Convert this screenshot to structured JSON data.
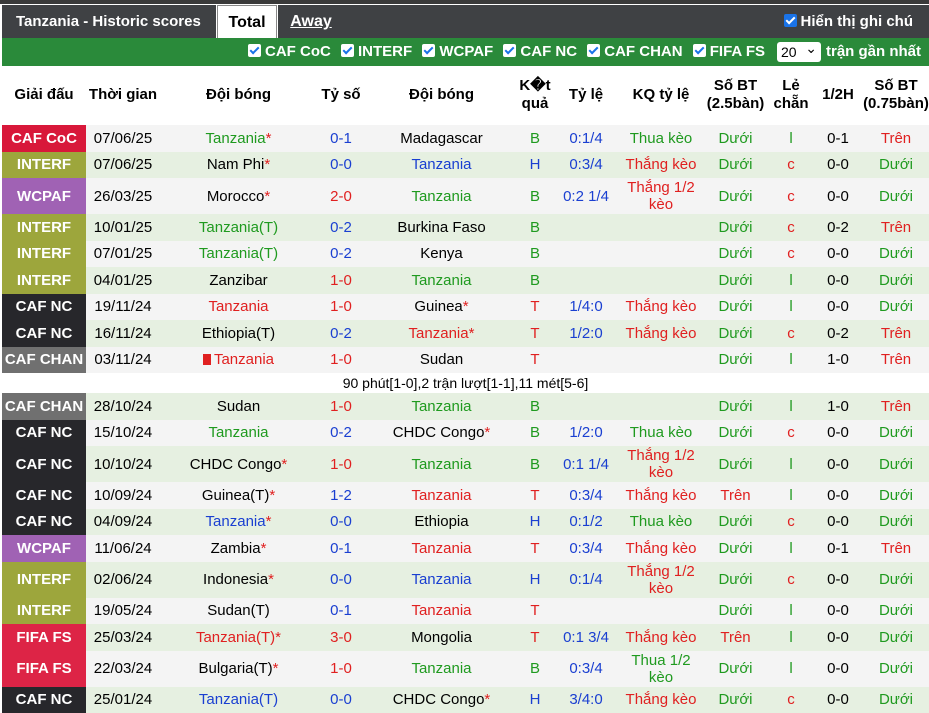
{
  "header": {
    "title": "Tanzania - Historic scores",
    "tab_total": "Total",
    "tab_away": "Away",
    "show_name_label": "Hiển thị ghi chú"
  },
  "filters": {
    "items": [
      "CAF CoC",
      "INTERF",
      "WCPAF",
      "CAF NC",
      "CAF CHAN",
      "FIFA FS"
    ],
    "count_value": "20",
    "recent_label": "trận gần nhất"
  },
  "columns": [
    "Giải đấu",
    "Thời gian",
    "Đội bóng",
    "Tỷ số",
    "Đội bóng",
    "K�t quả",
    "Tỷ lệ",
    "KQ tỷ lệ",
    "Số BT (2.5bàn)",
    "Lẻ chẵn",
    "1/2H",
    "Số BT (0.75bàn)"
  ],
  "colors": {
    "CAF CoC": "#d8183a",
    "INTERF": "#9da63c",
    "WCPAF": "#a062b4",
    "CAF NC": "#27272b",
    "CAF CHAN": "#707070",
    "FIFA FS": "#dd2446"
  },
  "rows": [
    {
      "comp": "CAF CoC",
      "date": "07/06/25",
      "home": "Tanzania",
      "home_mark": "*",
      "home_color": "green",
      "score": "0-1",
      "score_color": "blue",
      "away": "Madagascar",
      "away_mark": "",
      "away_color": "dark",
      "res": "B",
      "odds": "0:1/4",
      "oddres": "Thua kèo",
      "over": "Dưới",
      "oe": "l",
      "half": "0-1",
      "over2": "Trên"
    },
    {
      "comp": "INTERF",
      "date": "07/06/25",
      "home": "Nam Phi",
      "home_mark": "*",
      "home_color": "dark",
      "score": "0-0",
      "score_color": "blue",
      "away": "Tanzania",
      "away_mark": "",
      "away_color": "blue",
      "res": "H",
      "odds": "0:3/4",
      "oddres": "Thắng kèo",
      "over": "Dưới",
      "oe": "c",
      "half": "0-0",
      "over2": "Dưới"
    },
    {
      "comp": "WCPAF",
      "date": "26/03/25",
      "home": "Morocco",
      "home_mark": "*",
      "home_color": "dark",
      "score": "2-0",
      "score_color": "red",
      "away": "Tanzania",
      "away_mark": "",
      "away_color": "green",
      "res": "B",
      "odds": "0:2 1/4",
      "oddres": "Thắng 1/2 kèo",
      "over": "Dưới",
      "oe": "c",
      "half": "0-0",
      "over2": "Dưới"
    },
    {
      "comp": "INTERF",
      "date": "10/01/25",
      "home": "Tanzania(T)",
      "home_mark": "",
      "home_color": "green",
      "score": "0-2",
      "score_color": "blue",
      "away": "Burkina Faso",
      "away_mark": "",
      "away_color": "dark",
      "res": "B",
      "odds": "",
      "oddres": "",
      "over": "Dưới",
      "oe": "c",
      "half": "0-2",
      "over2": "Trên"
    },
    {
      "comp": "INTERF",
      "date": "07/01/25",
      "home": "Tanzania(T)",
      "home_mark": "",
      "home_color": "green",
      "score": "0-2",
      "score_color": "blue",
      "away": "Kenya",
      "away_mark": "",
      "away_color": "dark",
      "res": "B",
      "odds": "",
      "oddres": "",
      "over": "Dưới",
      "oe": "c",
      "half": "0-0",
      "over2": "Dưới"
    },
    {
      "comp": "INTERF",
      "date": "04/01/25",
      "home": "Zanzibar",
      "home_mark": "",
      "home_color": "dark",
      "score": "1-0",
      "score_color": "red",
      "away": "Tanzania",
      "away_mark": "",
      "away_color": "green",
      "res": "B",
      "odds": "",
      "oddres": "",
      "over": "Dưới",
      "oe": "l",
      "half": "0-0",
      "over2": "Dưới"
    },
    {
      "comp": "CAF NC",
      "date": "19/11/24",
      "home": "Tanzania",
      "home_mark": "",
      "home_color": "red",
      "score": "1-0",
      "score_color": "red",
      "away": "Guinea",
      "away_mark": "*",
      "away_color": "dark",
      "res": "T",
      "odds": "1/4:0",
      "oddres": "Thắng kèo",
      "over": "Dưới",
      "oe": "l",
      "half": "0-0",
      "over2": "Dưới"
    },
    {
      "comp": "CAF NC",
      "date": "16/11/24",
      "home": "Ethiopia(T)",
      "home_mark": "",
      "home_color": "dark",
      "score": "0-2",
      "score_color": "blue",
      "away": "Tanzania",
      "away_mark": "*",
      "away_color": "red",
      "res": "T",
      "odds": "1/2:0",
      "oddres": "Thắng kèo",
      "over": "Dưới",
      "oe": "c",
      "half": "0-2",
      "over2": "Trên"
    },
    {
      "comp": "CAF CHAN",
      "date": "03/11/24",
      "home": "Tanzania",
      "home_mark": "",
      "home_color": "red",
      "home_flag": true,
      "score": "1-0",
      "score_color": "red",
      "away": "Sudan",
      "away_mark": "",
      "away_color": "dark",
      "res": "T",
      "odds": "",
      "oddres": "",
      "over": "Dưới",
      "oe": "l",
      "half": "1-0",
      "over2": "Trên"
    },
    {
      "note": "90 phút[1-0],2 trận lượt[1-1],11 mét[5-6]"
    },
    {
      "comp": "CAF CHAN",
      "date": "28/10/24",
      "home": "Sudan",
      "home_mark": "",
      "home_color": "dark",
      "score": "1-0",
      "score_color": "red",
      "away": "Tanzania",
      "away_mark": "",
      "away_color": "green",
      "res": "B",
      "odds": "",
      "oddres": "",
      "over": "Dưới",
      "oe": "l",
      "half": "1-0",
      "over2": "Trên"
    },
    {
      "comp": "CAF NC",
      "date": "15/10/24",
      "home": "Tanzania",
      "home_mark": "",
      "home_color": "green",
      "score": "0-2",
      "score_color": "blue",
      "away": "CHDC Congo",
      "away_mark": "*",
      "away_color": "dark",
      "res": "B",
      "odds": "1/2:0",
      "oddres": "Thua kèo",
      "over": "Dưới",
      "oe": "c",
      "half": "0-0",
      "over2": "Dưới"
    },
    {
      "comp": "CAF NC",
      "date": "10/10/24",
      "home": "CHDC Congo",
      "home_mark": "*",
      "home_color": "dark",
      "score": "1-0",
      "score_color": "red",
      "away": "Tanzania",
      "away_mark": "",
      "away_color": "green",
      "res": "B",
      "odds": "0:1 1/4",
      "oddres": "Thắng 1/2 kèo",
      "over": "Dưới",
      "oe": "l",
      "half": "0-0",
      "over2": "Dưới"
    },
    {
      "comp": "CAF NC",
      "date": "10/09/24",
      "home": "Guinea(T)",
      "home_mark": "*",
      "home_color": "dark",
      "score": "1-2",
      "score_color": "blue",
      "away": "Tanzania",
      "away_mark": "",
      "away_color": "red",
      "res": "T",
      "odds": "0:3/4",
      "oddres": "Thắng kèo",
      "over": "Trên",
      "oe": "l",
      "half": "0-0",
      "over2": "Dưới"
    },
    {
      "comp": "CAF NC",
      "date": "04/09/24",
      "home": "Tanzania",
      "home_mark": "*",
      "home_color": "blue",
      "score": "0-0",
      "score_color": "blue",
      "away": "Ethiopia",
      "away_mark": "",
      "away_color": "dark",
      "res": "H",
      "odds": "0:1/2",
      "oddres": "Thua kèo",
      "over": "Dưới",
      "oe": "c",
      "half": "0-0",
      "over2": "Dưới"
    },
    {
      "comp": "WCPAF",
      "date": "11/06/24",
      "home": "Zambia",
      "home_mark": "*",
      "home_color": "dark",
      "score": "0-1",
      "score_color": "blue",
      "away": "Tanzania",
      "away_mark": "",
      "away_color": "red",
      "res": "T",
      "odds": "0:3/4",
      "oddres": "Thắng kèo",
      "over": "Dưới",
      "oe": "l",
      "half": "0-1",
      "over2": "Trên"
    },
    {
      "comp": "INTERF",
      "date": "02/06/24",
      "home": "Indonesia",
      "home_mark": "*",
      "home_color": "dark",
      "score": "0-0",
      "score_color": "blue",
      "away": "Tanzania",
      "away_mark": "",
      "away_color": "blue",
      "res": "H",
      "odds": "0:1/4",
      "oddres": "Thắng 1/2 kèo",
      "over": "Dưới",
      "oe": "c",
      "half": "0-0",
      "over2": "Dưới"
    },
    {
      "comp": "INTERF",
      "date": "19/05/24",
      "home": "Sudan(T)",
      "home_mark": "",
      "home_color": "dark",
      "score": "0-1",
      "score_color": "blue",
      "away": "Tanzania",
      "away_mark": "",
      "away_color": "red",
      "res": "T",
      "odds": "",
      "oddres": "",
      "over": "Dưới",
      "oe": "l",
      "half": "0-0",
      "over2": "Dưới"
    },
    {
      "comp": "FIFA FS",
      "date": "25/03/24",
      "home": "Tanzania(T)",
      "home_mark": "*",
      "home_color": "red",
      "score": "3-0",
      "score_color": "red",
      "away": "Mongolia",
      "away_mark": "",
      "away_color": "dark",
      "res": "T",
      "odds": "0:1 3/4",
      "oddres": "Thắng kèo",
      "over": "Trên",
      "oe": "l",
      "half": "0-0",
      "over2": "Dưới"
    },
    {
      "comp": "FIFA FS",
      "date": "22/03/24",
      "home": "Bulgaria(T)",
      "home_mark": "*",
      "home_color": "dark",
      "score": "1-0",
      "score_color": "red",
      "away": "Tanzania",
      "away_mark": "",
      "away_color": "green",
      "res": "B",
      "odds": "0:3/4",
      "oddres": "Thua 1/2 kèo",
      "over": "Dưới",
      "oe": "l",
      "half": "0-0",
      "over2": "Dưới"
    },
    {
      "comp": "CAF NC",
      "date": "25/01/24",
      "home": "Tanzania(T)",
      "home_mark": "",
      "home_color": "blue",
      "score": "0-0",
      "score_color": "blue",
      "away": "CHDC Congo",
      "away_mark": "*",
      "away_color": "dark",
      "res": "H",
      "odds": "3/4:0",
      "oddres": "Thắng kèo",
      "over": "Dưới",
      "oe": "c",
      "half": "0-0",
      "over2": "Dưới"
    }
  ]
}
